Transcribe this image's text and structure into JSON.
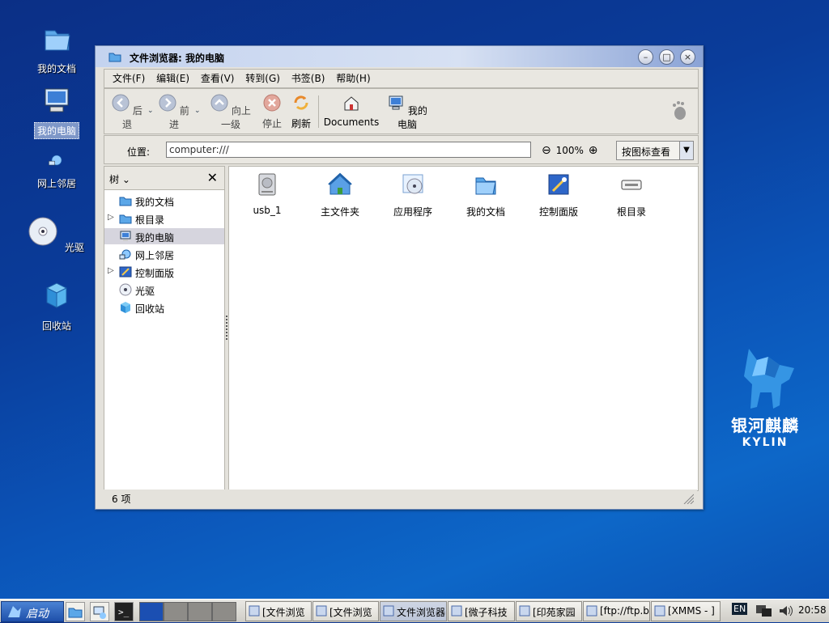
{
  "desktop": {
    "icons": [
      {
        "label": "我的文档"
      },
      {
        "label": "我的电脑"
      },
      {
        "label": "网上邻居"
      },
      {
        "label": "光驱"
      },
      {
        "label": "回收站"
      }
    ],
    "logo": {
      "cn": "银河麒麟",
      "en": "KYLIN"
    }
  },
  "window": {
    "title": "文件浏览器: 我的电脑",
    "menu": [
      "文件(F)",
      "编辑(E)",
      "查看(V)",
      "转到(G)",
      "书签(B)",
      "帮助(H)"
    ],
    "toolbar": {
      "back": "后退",
      "forward": "前进",
      "up": "向上一级",
      "stop": "停止",
      "reload": "刷新",
      "documents": "Documents",
      "computer": "我的电脑"
    },
    "location": {
      "label": "位置:",
      "value": "computer:///",
      "zoom": "100%",
      "view_mode": "按图标查看"
    },
    "sidebar": {
      "title": "树",
      "items": [
        {
          "label": "我的文档",
          "expandable": false,
          "selected": false
        },
        {
          "label": "根目录",
          "expandable": true,
          "selected": false
        },
        {
          "label": "我的电脑",
          "expandable": false,
          "selected": true
        },
        {
          "label": "网上邻居",
          "expandable": false,
          "selected": false
        },
        {
          "label": "控制面版",
          "expandable": true,
          "selected": false
        },
        {
          "label": "光驱",
          "expandable": false,
          "selected": false
        },
        {
          "label": "回收站",
          "expandable": false,
          "selected": false
        }
      ]
    },
    "files": [
      {
        "label": "usb_1",
        "icon": "drive-icon"
      },
      {
        "label": "主文件夹",
        "icon": "home-folder-icon"
      },
      {
        "label": "应用程序",
        "icon": "applications-icon"
      },
      {
        "label": "我的文档",
        "icon": "documents-folder-icon"
      },
      {
        "label": "控制面版",
        "icon": "control-panel-icon"
      },
      {
        "label": "根目录",
        "icon": "root-drive-icon"
      }
    ],
    "status": "6 项"
  },
  "taskbar": {
    "start": "启动",
    "tasks": [
      {
        "label": "[文件浏览",
        "active": false
      },
      {
        "label": "[文件浏览",
        "active": false
      },
      {
        "label": "文件浏览器",
        "active": true
      },
      {
        "label": "[微子科技",
        "active": false
      },
      {
        "label": "[印苑家园",
        "active": false
      },
      {
        "label": "[ftp://ftp.b",
        "active": false
      },
      {
        "label": "[XMMS - ]",
        "active": false
      }
    ],
    "lang": "EN",
    "clock": "20:58"
  },
  "colors": {
    "desktop": "#0b4aa8",
    "selection": "#d6d5de",
    "title_gradient_end": "#8aa3d6"
  }
}
